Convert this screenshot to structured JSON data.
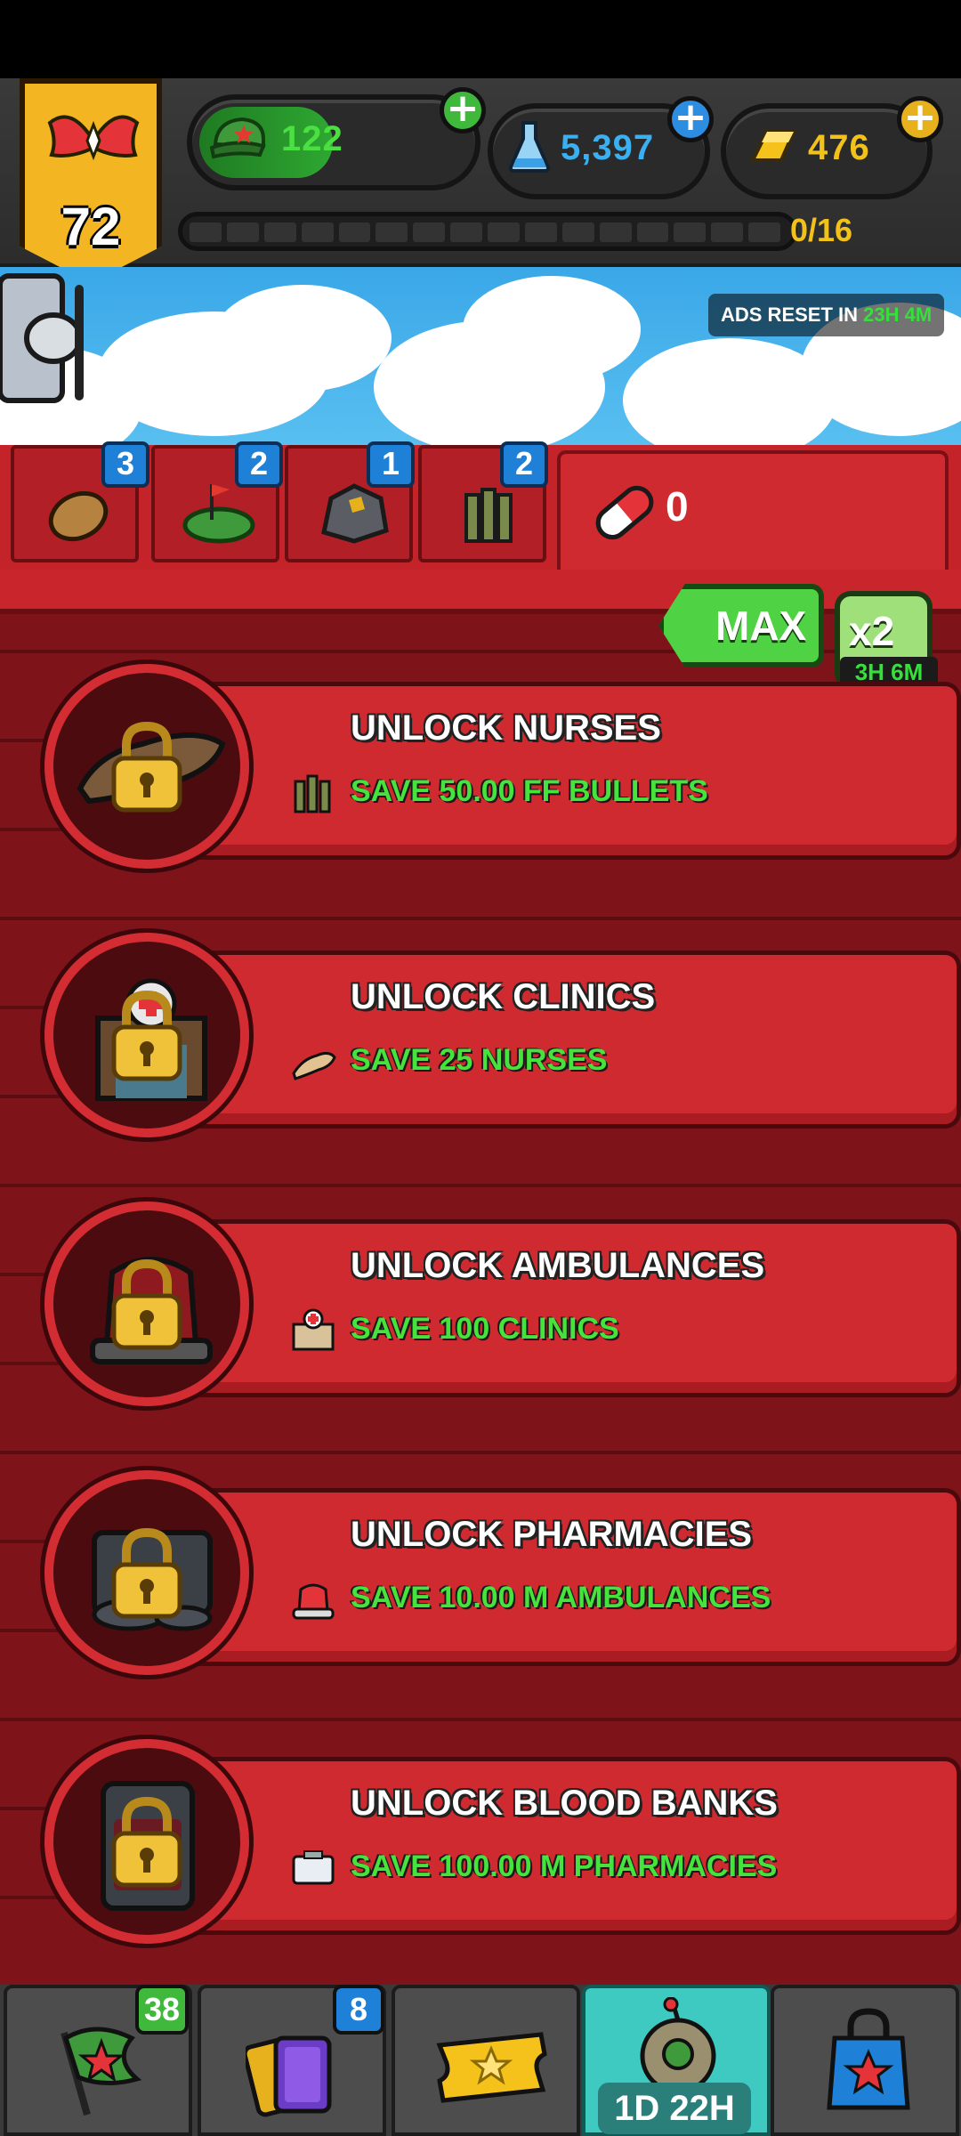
{
  "hud": {
    "rank_level": "72",
    "soldiers": "122",
    "science": "5,397",
    "gold": "476",
    "progress_label": "0/16",
    "progress_fraction": 0
  },
  "sky": {
    "ads_reset_prefix": "ADS RESET IN",
    "ads_reset_time": "23H 4M"
  },
  "tabs": [
    {
      "icon": "potato-icon",
      "badge": "3"
    },
    {
      "icon": "field-flag-icon",
      "badge": "2"
    },
    {
      "icon": "ore-rock-icon",
      "badge": "1"
    },
    {
      "icon": "bullets-icon",
      "badge": "2"
    }
  ],
  "active_tab": {
    "icon": "pill-capsule-icon",
    "count": "0"
  },
  "controls": {
    "max_label": "MAX",
    "boost_label": "x2",
    "boost_time": "3H 6M"
  },
  "unlocks": [
    {
      "title": "UNLOCK NURSES",
      "requirement": "SAVE 50.00 FF BULLETS",
      "req_icon": "bullets-icon",
      "item_icon": "bandage-icon"
    },
    {
      "title": "UNLOCK CLINICS",
      "requirement": "SAVE 25 NURSES",
      "req_icon": "bandage-icon",
      "item_icon": "clinic-icon"
    },
    {
      "title": "UNLOCK AMBULANCES",
      "requirement": "SAVE 100 CLINICS",
      "req_icon": "clinic-icon",
      "item_icon": "siren-icon"
    },
    {
      "title": "UNLOCK PHARMACIES",
      "requirement": "SAVE 10.00 M AMBULANCES",
      "req_icon": "siren-icon",
      "item_icon": "medkit-icon"
    },
    {
      "title": "UNLOCK BLOOD BANKS",
      "requirement": "SAVE 100.00 M PHARMACIES",
      "req_icon": "medkit-icon",
      "item_icon": "blood-bag-icon"
    }
  ],
  "nav": {
    "missions_badge": "38",
    "cards_badge": "8",
    "event_timer": "1D 22H"
  },
  "colors": {
    "panel_red": "#cf2a30",
    "accent_green": "#46e33c",
    "badge_blue": "#1e80d6",
    "gold": "#f2c21a"
  }
}
